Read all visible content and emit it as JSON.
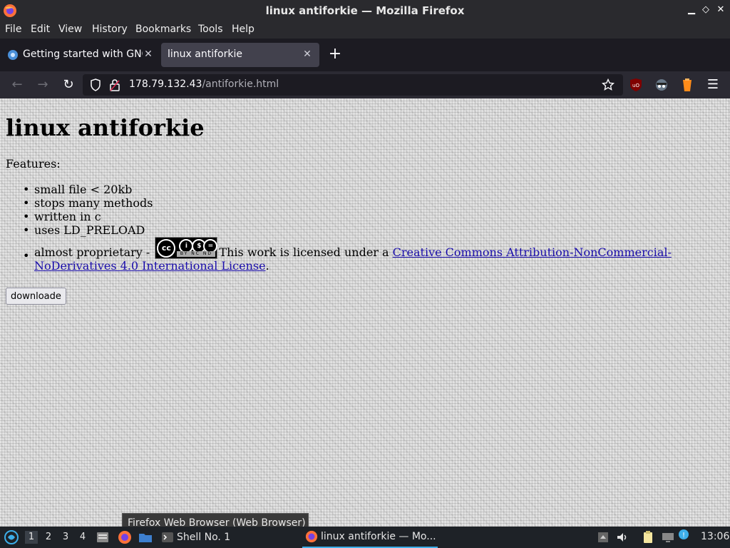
{
  "window": {
    "title": "linux antiforkie — Mozilla Firefox",
    "minimize": "▁",
    "maximize": "◇",
    "close": "✕"
  },
  "menu": [
    "File",
    "Edit",
    "View",
    "History",
    "Bookmarks",
    "Tools",
    "Help"
  ],
  "tabs": [
    {
      "label": "Getting started with GNO",
      "active": false
    },
    {
      "label": "linux antiforkie",
      "active": true
    }
  ],
  "newtab": "+",
  "nav": {
    "back": "←",
    "forward": "→",
    "reload": "↻",
    "url_host": "178.79.132.43",
    "url_path": "/antiforkie.html"
  },
  "page": {
    "heading": "linux antiforkie",
    "features_label": "Features:",
    "features": [
      "small file < 20kb",
      "stops many methods",
      "written in c",
      "uses LD_PRELOAD"
    ],
    "license_prefix": "almost proprietary - ",
    "license_text": "This work is licensed under a ",
    "license_link": "Creative Commons Attribution-NonCommercial-NoDerivatives 4.0 International License",
    "license_suffix": ".",
    "badge_text": "BY NC ND",
    "download_label": "downloade"
  },
  "tooltip": "Firefox Web Browser (Web Browser)",
  "taskbar": {
    "workspaces": [
      "1",
      "2",
      "3",
      "4"
    ],
    "active_workspace": "1",
    "shell_label": "Shell No. 1",
    "firefox_task": "linux antiforkie — Mo...",
    "clock": "13:06"
  },
  "colors": {
    "link": "#1a0dab",
    "accent": "#3daee9"
  }
}
